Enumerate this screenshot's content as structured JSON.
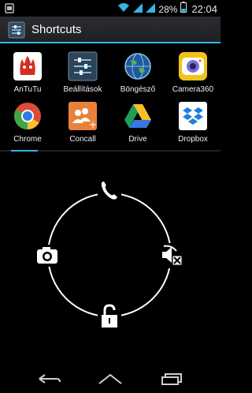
{
  "status_bar": {
    "battery_percent": "28%",
    "time": "22:04",
    "icons": [
      "notification-icon",
      "wifi-icon",
      "signal-icon",
      "signal-icon",
      "battery-icon"
    ]
  },
  "action_bar": {
    "title": "Shortcuts",
    "icon": "shortcuts-app-icon"
  },
  "apps": [
    {
      "label": "AnTuTu",
      "icon": "antutu-icon"
    },
    {
      "label": "Beállítások",
      "icon": "settings-icon"
    },
    {
      "label": "Böngésző",
      "icon": "browser-globe-icon"
    },
    {
      "label": "Camera360",
      "icon": "camera360-icon"
    },
    {
      "label": "Chrome",
      "icon": "chrome-icon"
    },
    {
      "label": "Concall",
      "icon": "concall-icon"
    },
    {
      "label": "Drive",
      "icon": "drive-icon"
    },
    {
      "label": "Dropbox",
      "icon": "dropbox-icon"
    }
  ],
  "lock_ring": {
    "targets": [
      "phone-icon",
      "camera-icon",
      "silent-mode-icon",
      "unlock-icon"
    ]
  },
  "nav_bar": {
    "buttons": [
      "back-icon",
      "home-icon",
      "recents-icon"
    ]
  },
  "colors": {
    "accent": "#33b5e5",
    "background": "#000000"
  }
}
